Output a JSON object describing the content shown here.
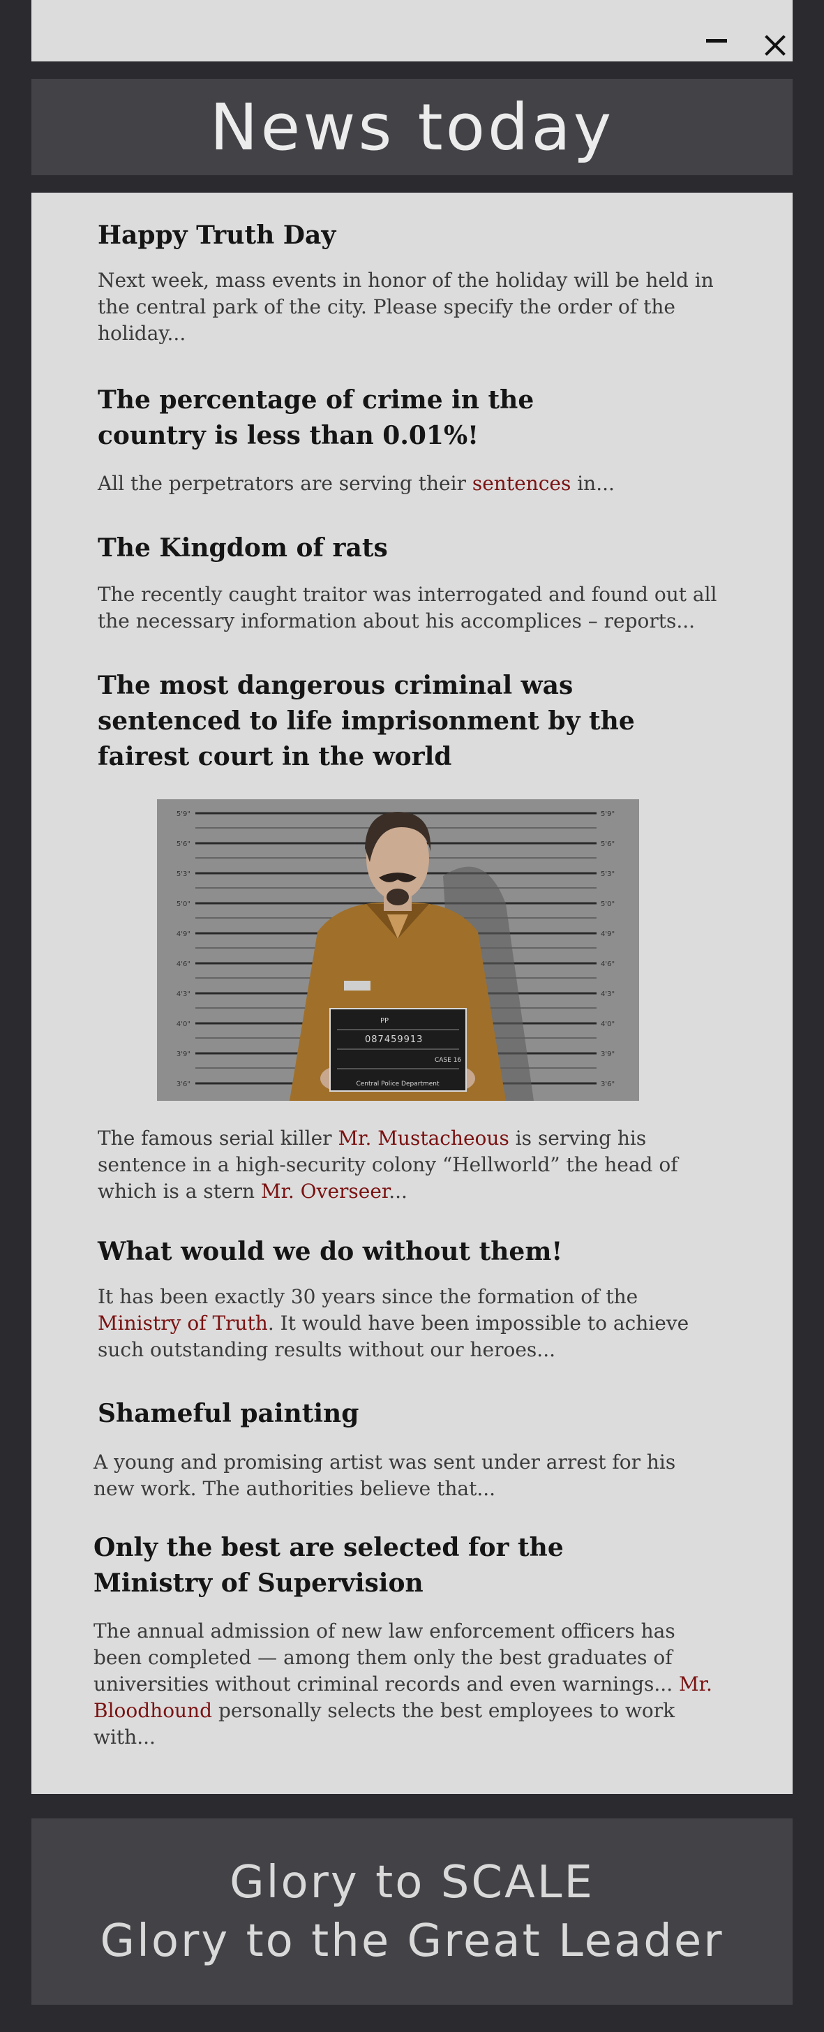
{
  "window": {
    "minimize_icon": "minimize-icon",
    "close_icon": "close-icon"
  },
  "header": {
    "title": "News today"
  },
  "articles": [
    {
      "headline": "Happy Truth Day",
      "body": "Next week, mass events in honor of the holiday will be held in the central park of the city. Please specify the order of the holiday..."
    },
    {
      "headline": "The percentage of crime in the country is less than 0.01%!",
      "body_pre": "All the perpetrators are serving their ",
      "link": "sentences",
      "body_post": " in..."
    },
    {
      "headline": "The Kingdom of rats",
      "body": "The recently caught traitor was interrogated and found out all the necessary information about his accomplices – reports..."
    },
    {
      "headline": "The most dangerous criminal was sentenced to life imprisonment by the fairest court in the world",
      "image": {
        "board_top": "PP",
        "board_number": "087459913",
        "board_case": "CASE 16",
        "board_footer": "Central Police Department",
        "height_marks": [
          "5'9\"",
          "5'6\"",
          "5'3\"",
          "5'0\"",
          "4'9\"",
          "4'6\"",
          "4'3\"",
          "4'0\"",
          "3'9\"",
          "3'6\""
        ]
      },
      "body_1": "The famous serial killer ",
      "link_1": "Mr. Mustacheous",
      "body_2": " is serving his sentence in a high-security colony “Hellworld” the head of which is a stern ",
      "link_2": "Mr. Overseer",
      "body_3": "..."
    },
    {
      "headline": "What would we do without them!",
      "body_pre": "It has been exactly 30 years since the formation of the ",
      "link": "Ministry of Truth",
      "body_post": ". It would have been impossible to achieve such outstanding results without our heroes..."
    },
    {
      "headline": "Shameful painting",
      "body": "A young and promising artist was sent under arrest for his new work. The authorities believe that..."
    },
    {
      "headline": "Only the best are selected for the Ministry of Supervision",
      "body_pre": "The annual admission of new law enforcement officers has been completed — among them only the best graduates of universities without criminal records and even warnings... ",
      "link": "Mr. Bloodhound",
      "body_post": " personally selects the best employees to work with..."
    }
  ],
  "footer": {
    "line1": "Glory to SCALE",
    "line2": "Glory to the Great Leader"
  }
}
